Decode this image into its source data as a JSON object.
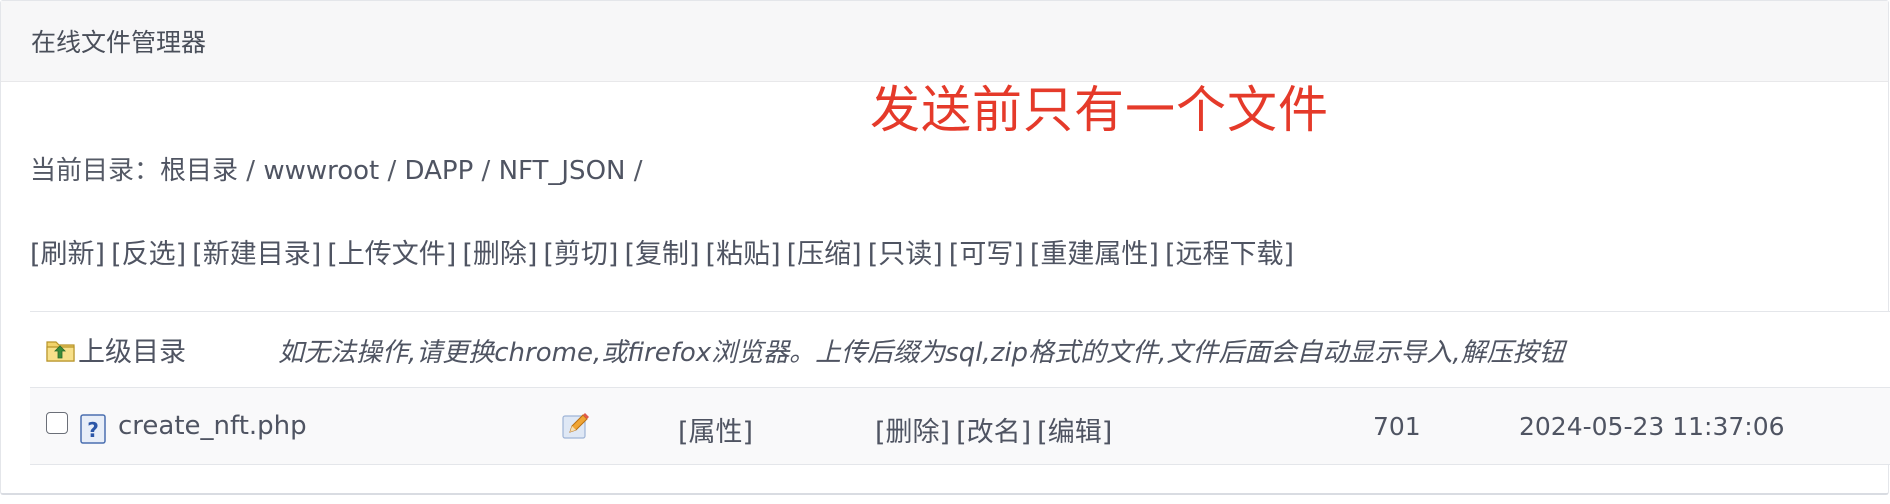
{
  "panel": {
    "title": "在线文件管理器"
  },
  "annotation": "发送前只有一个文件",
  "breadcrumb": {
    "label": "当前目录：",
    "crumbs": [
      "根目录",
      "wwwroot",
      "DAPP",
      "NFT_JSON"
    ],
    "separator": " / "
  },
  "toolbar": {
    "items": [
      "[刷新]",
      "[反选]",
      "[新建目录]",
      "[上传文件]",
      "[删除]",
      "[剪切]",
      "[复制]",
      "[粘贴]",
      "[压缩]",
      "[只读]",
      "[可写]",
      "[重建属性]",
      "[远程下载]"
    ]
  },
  "parent_row": {
    "icon": "folder-up-icon",
    "label": "上级目录",
    "hint": "如无法操作,请更换chrome,或firefox浏览器。上传后缀为sql,zip格式的文件,文件后面会自动显示导入,解压按钮"
  },
  "files": [
    {
      "name": "create_nft.php",
      "icon": "unknown-file-icon",
      "edit_icon": "pencil-edit-icon",
      "props_label": "[属性]",
      "actions": [
        "[删除]",
        "[改名]",
        "[编辑]"
      ],
      "size": "701",
      "modified": "2024-05-23 11:37:06",
      "checked": false
    }
  ],
  "colors": {
    "annotation": "#e53a2a",
    "text": "#4f5462",
    "header_bg": "#f7f7f8"
  }
}
